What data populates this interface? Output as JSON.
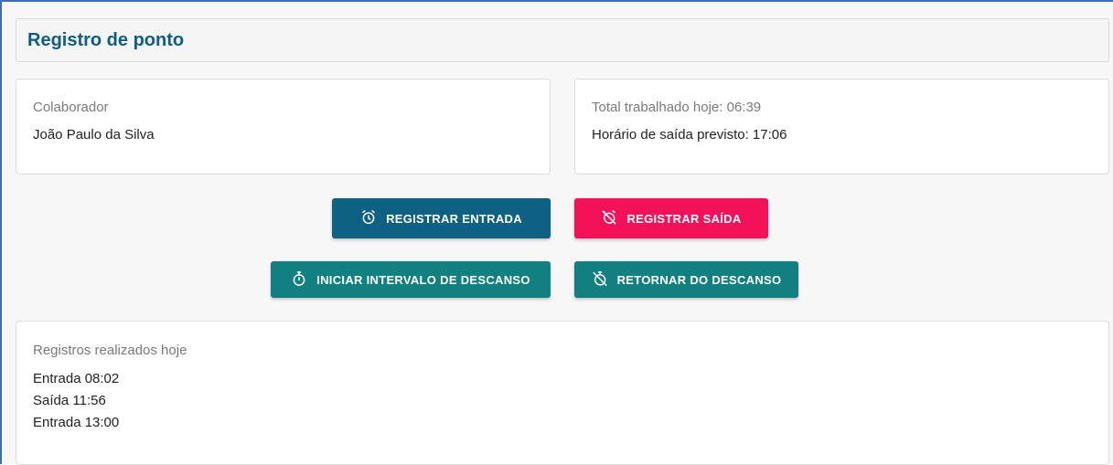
{
  "header": {
    "title": "Registro de ponto"
  },
  "colaborador": {
    "label": "Colaborador",
    "name": "João Paulo da Silva"
  },
  "resumo": {
    "total_trabalhado": "Total trabalhado hoje: 06:39",
    "saida_prevista": "Horário de saída previsto: 17:06"
  },
  "actions": {
    "registrar_entrada": {
      "label": "REGISTRAR ENTRADA",
      "icon": "alarm-clock-icon",
      "color": "#0f6184"
    },
    "registrar_saida": {
      "label": "REGISTRAR SAÍDA",
      "icon": "alarm-off-icon",
      "color": "#f3115a"
    },
    "iniciar_intervalo": {
      "label": "INICIAR INTERVALO DE DESCANSO",
      "icon": "stopwatch-icon",
      "color": "#128080"
    },
    "retornar_descanso": {
      "label": "RETORNAR DO DESCANSO",
      "icon": "stopwatch-off-icon",
      "color": "#128080"
    }
  },
  "registros": {
    "label": "Registros realizados hoje",
    "items": [
      "Entrada 08:02",
      "Saída 11:56",
      "Entrada 13:00"
    ]
  }
}
